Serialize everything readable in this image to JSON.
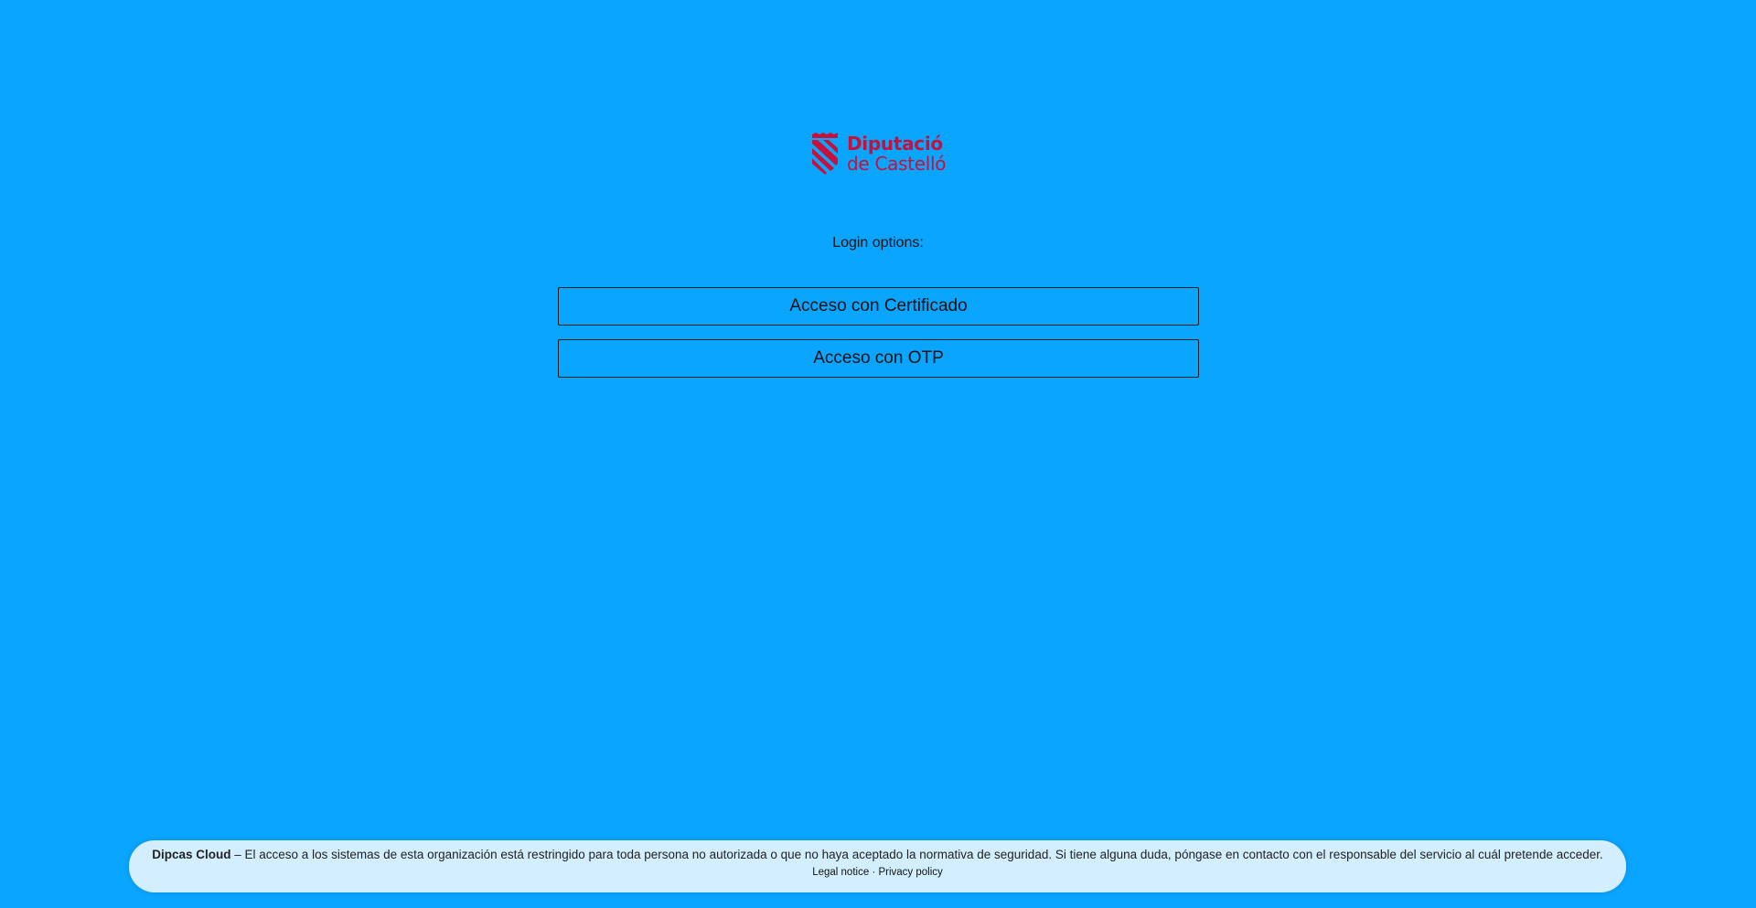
{
  "logo": {
    "line1": "Diputació",
    "line2": "de Castelló",
    "color": "#c8103a",
    "icon": "shield-stripes-icon"
  },
  "login": {
    "label": "Login options:",
    "buttons": [
      {
        "label": "Acceso con Certificado"
      },
      {
        "label": "Acceso con OTP"
      }
    ]
  },
  "footer": {
    "brand": "Dipcas Cloud",
    "message": " – El acceso a los sistemas de esta organización está restringido para toda persona no autorizada o que no haya aceptado la normativa de seguridad. Si tiene alguna duda, póngase en contacto con el responsable del servicio al cuál pretende acceder.",
    "links": [
      {
        "label": "Legal notice"
      },
      {
        "label": "Privacy policy"
      }
    ],
    "separator": "·"
  },
  "colors": {
    "background": "#0aa5ff",
    "footer_background": "#d3efff"
  }
}
